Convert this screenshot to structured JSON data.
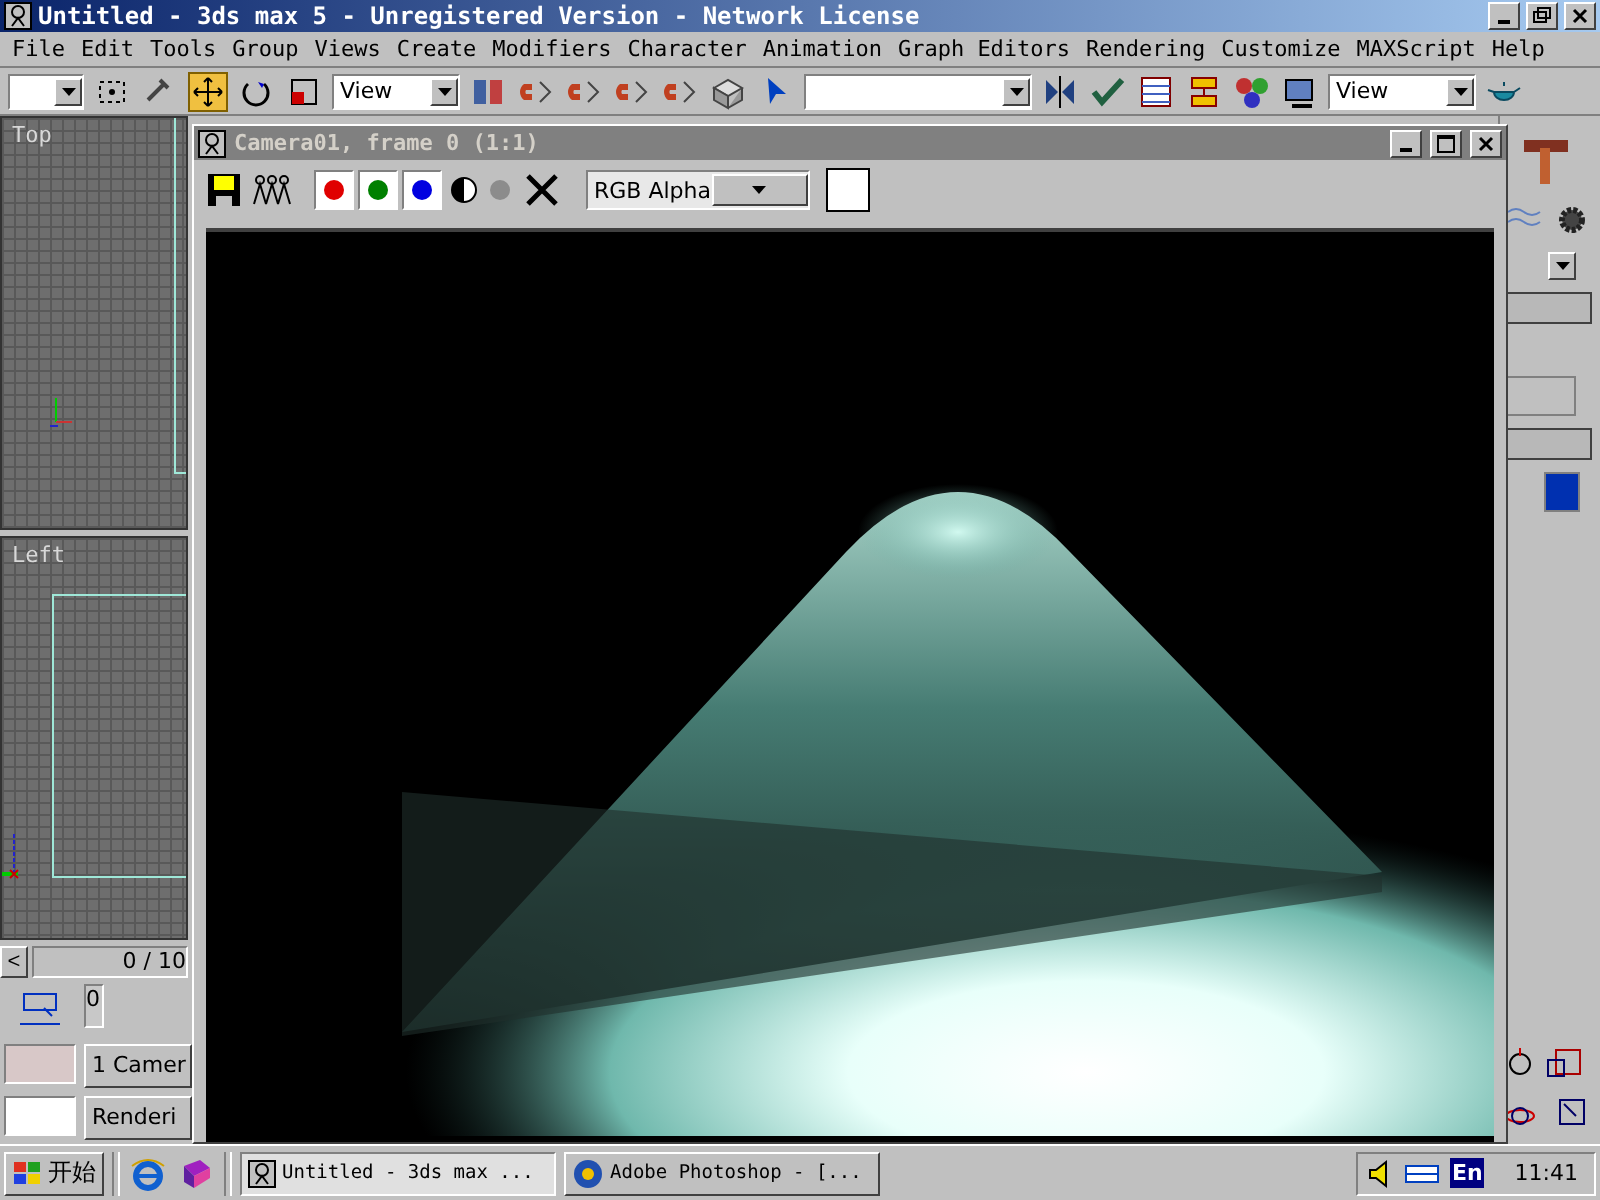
{
  "app": {
    "title": "Untitled - 3ds max 5 - Unregistered Version - Network License",
    "menus": [
      "File",
      "Edit",
      "Tools",
      "Group",
      "Views",
      "Create",
      "Modifiers",
      "Character",
      "Animation",
      "Graph Editors",
      "Rendering",
      "Customize",
      "MAXScript",
      "Help"
    ],
    "toolbar": {
      "coord_dropdown": "View",
      "view_dropdown": "View"
    }
  },
  "viewports": [
    {
      "label": "Top"
    },
    {
      "label": "Left"
    }
  ],
  "timeline": {
    "prev": "<",
    "frame": "0 / 10",
    "slider_value": "0",
    "level": 0
  },
  "bottom_fields": [
    "1 Camer",
    "Renderi"
  ],
  "render_window": {
    "title": "Camera01, frame 0 (1:1)",
    "channels": [
      {
        "color": "#e00000",
        "on": true
      },
      {
        "color": "#008000",
        "on": true
      },
      {
        "color": "#0000e0",
        "on": true
      }
    ],
    "channel_dropdown": "RGB Alpha"
  },
  "taskbar": {
    "start": "开始",
    "tasks": [
      {
        "label": "Untitled - 3ds max ...",
        "selected": true
      },
      {
        "label": "Adobe Photoshop - [...",
        "selected": false
      }
    ],
    "language": "En",
    "clock": "11:41"
  }
}
